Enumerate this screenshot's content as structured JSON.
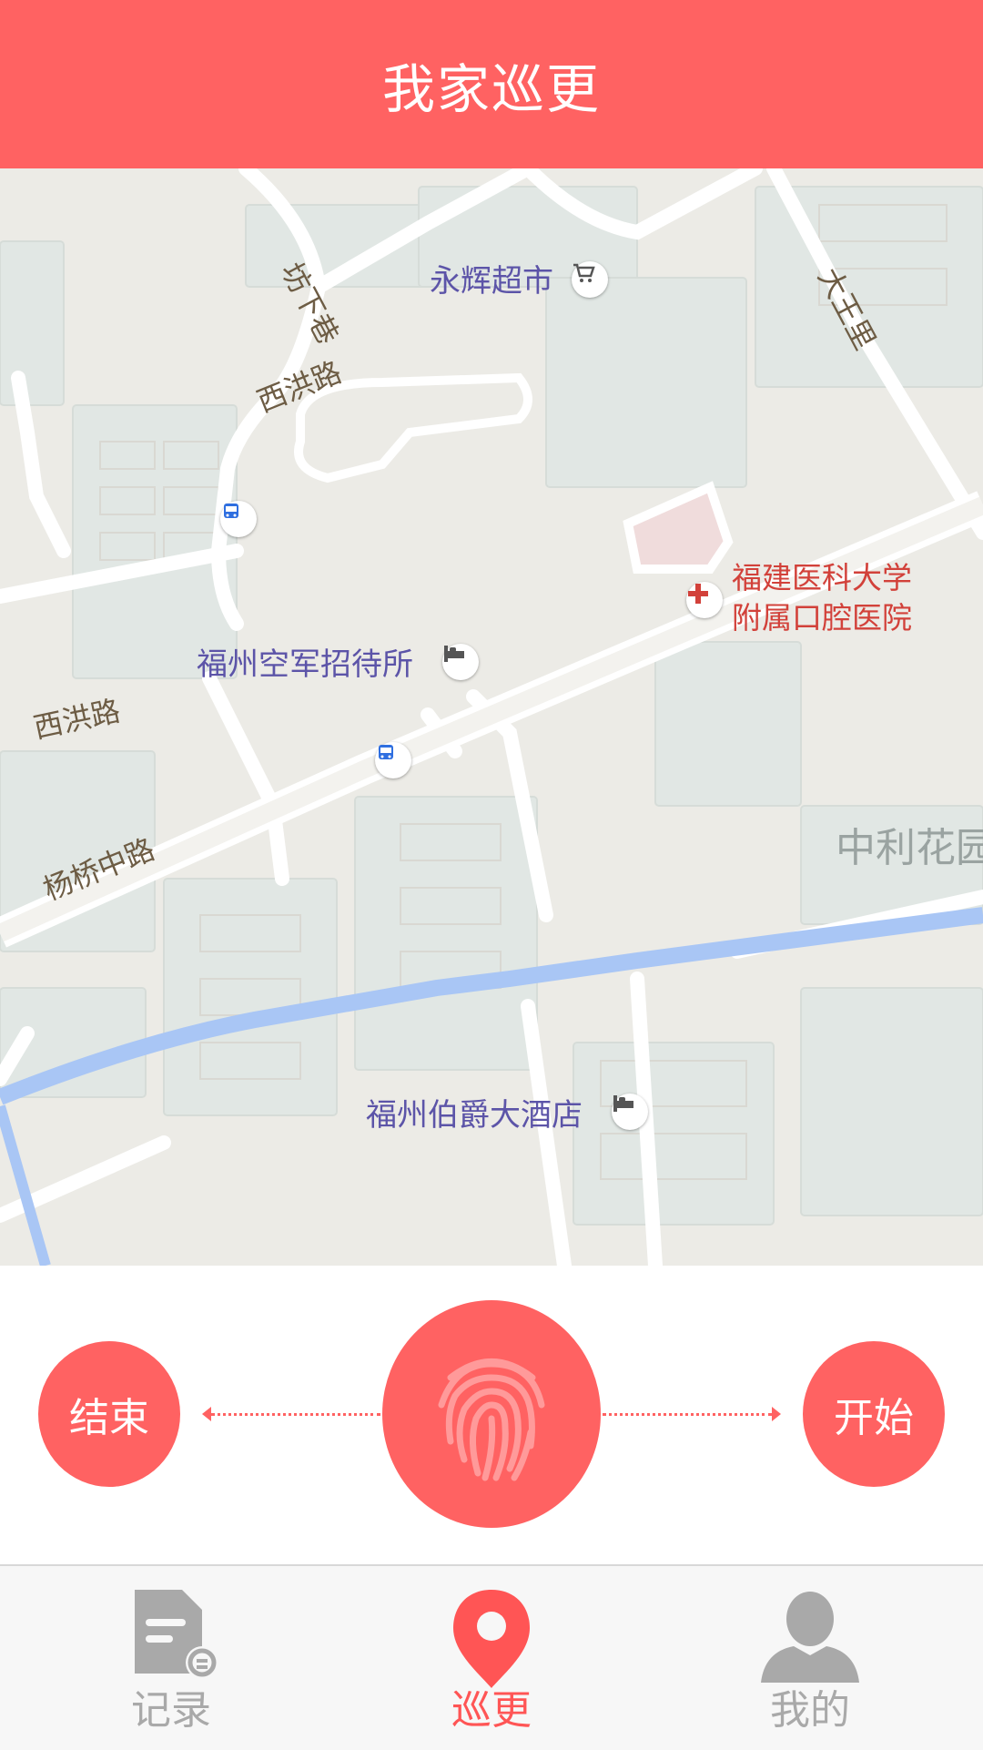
{
  "header": {
    "title": "我家巡更"
  },
  "map": {
    "pois": [
      {
        "name": "永辉超市",
        "icon": "shopping-cart-icon"
      },
      {
        "name": "福州空军招待所",
        "icon": "hotel-bed-icon"
      },
      {
        "name": "福州伯爵大酒店",
        "icon": "hotel-bed-icon"
      }
    ],
    "hospital": {
      "line1": "福建医科大学",
      "line2": "附属口腔医院",
      "icon": "hospital-cross-icon"
    },
    "roads": [
      "坊下巷",
      "西洪路",
      "西洪路",
      "大王里",
      "杨桥中路"
    ],
    "district": "中利花园"
  },
  "controls": {
    "end_label": "结束",
    "start_label": "开始",
    "scan_icon": "fingerprint-icon"
  },
  "tabs": [
    {
      "label": "记录",
      "icon": "record-document-icon",
      "active": false
    },
    {
      "label": "巡更",
      "icon": "location-pin-icon",
      "active": true
    },
    {
      "label": "我的",
      "icon": "user-silhouette-icon",
      "active": false
    }
  ],
  "colors": {
    "accent": "#ff6262",
    "inactive": "#a9a9a9",
    "poi": "#5c54a8",
    "hospital": "#d2413a",
    "road_label": "#6d5c44",
    "water": "#a9c6f5"
  }
}
